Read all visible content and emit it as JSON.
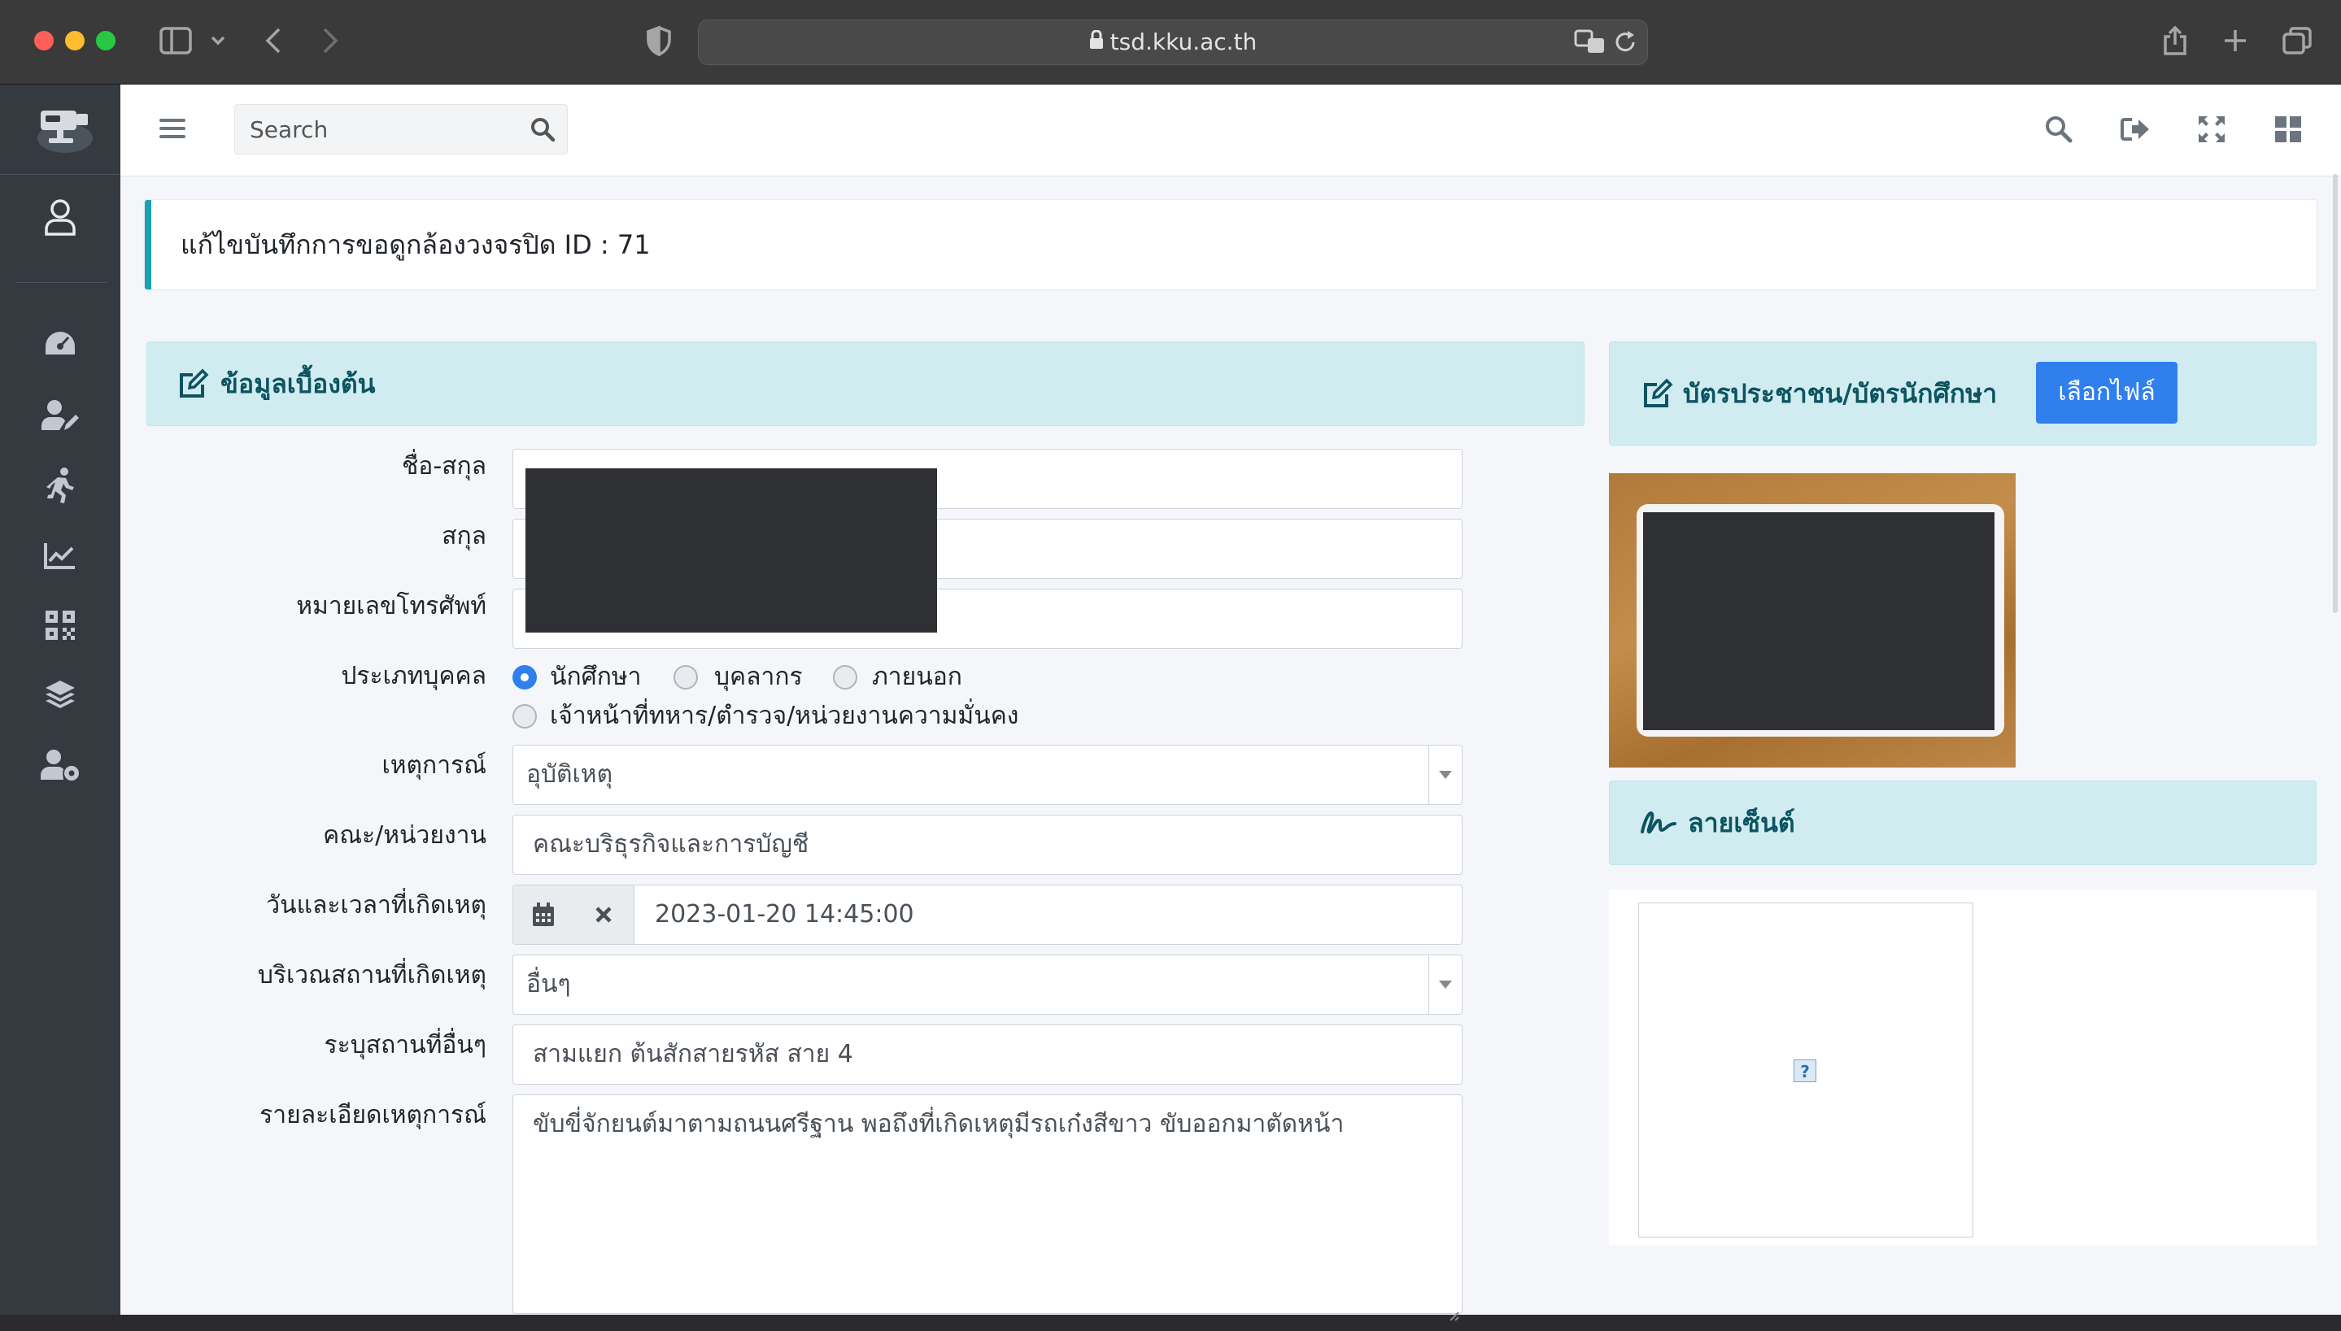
{
  "browser": {
    "url": "tsd.kku.ac.th"
  },
  "topnav": {
    "search_placeholder": "Search"
  },
  "page": {
    "title": "แก้ไขบันทึกการขอดูกล้องวงจรปิด ID : 71"
  },
  "basic_info": {
    "header": "ข้อมูลเบื้องต้น",
    "labels": {
      "fullname": "ชื่อ-สกุล",
      "surname": "สกุล",
      "phone": "หมายเลขโทรศัพท์",
      "person_type": "ประเภทบุคคล",
      "event": "เหตุการณ์",
      "faculty": "คณะ/หน่วยงาน",
      "datetime": "วันและเวลาที่เกิดเหตุ",
      "location": "บริเวณสถานที่เกิดเหตุ",
      "other_location": "ระบุสถานที่อื่นๆ",
      "details": "รายละเอียดเหตุการณ์"
    },
    "person_types": {
      "student": "นักศึกษา",
      "staff": "บุคลากร",
      "outsider": "ภายนอก",
      "security": "เจ้าหน้าที่ทหาร/ตำรวจ/หน่วยงานความมั่นคง",
      "selected": "นักศึกษา"
    },
    "values": {
      "event": "อุบัติเหตุ",
      "faculty": "คณะบริธุรกิจและการบัญชี",
      "datetime": "2023-01-20 14:45:00",
      "location": "อื่นๆ",
      "other_location": "สามแยก ต้นสักสายรหัส สาย 4",
      "details": "ขับขี่จักยนต์มาตามถนนศรีฐาน พอถึงที่เกิดเหตุมีรถเก๋งสีขาว ขับออกมาตัดหน้า"
    }
  },
  "id_card": {
    "header": "บัตรประชาชน/บัตรนักศึกษา",
    "choose_file": "เลือกไฟล์"
  },
  "signature": {
    "header": "ลายเซ็นต์",
    "broken_image_glyph": "?"
  },
  "colors": {
    "accent": "#2f80ed",
    "sidebar": "#343a40",
    "section_bg": "#d1ecf1",
    "section_text": "#0c5460",
    "page_head_border": "#17a2b8"
  }
}
